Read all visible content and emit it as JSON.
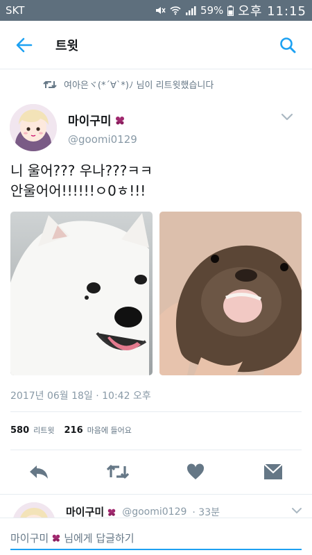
{
  "status_bar": {
    "carrier": "SKT",
    "battery": "59%",
    "time": "오후 11:15"
  },
  "app_bar": {
    "title": "트윗"
  },
  "retweet_context": {
    "text": "여아은ヾ(*´∀`*)ﾉ 님이 리트윗했습니다"
  },
  "tweet": {
    "author_name": "마이구미",
    "author_handle": "@goomi0129",
    "text_line1": "니 울어??? 우나???ㅋㅋ",
    "text_line2": "안울어어!!!!!!ㅇ0ㅎ!!!",
    "media": [
      {
        "name": "samoyed-dog-photo",
        "alt": "white fluffy dog"
      },
      {
        "name": "otter-photo",
        "alt": "otter held in hand"
      }
    ],
    "timestamp": "2017년 06월 18일 · 10:42 오후",
    "retweets_count": "580",
    "retweets_label": "리트윗",
    "likes_count": "216",
    "likes_label": "마음에 들어요"
  },
  "actions": {
    "reply_icon": "reply-icon",
    "retweet_icon": "retweet-icon",
    "like_icon": "heart-icon",
    "dm_icon": "direct-message-icon"
  },
  "reply_preview": {
    "author_name": "마이구미",
    "author_handle": "@goomi0129",
    "age": "· 33분"
  },
  "compose": {
    "to_name": "마이구미",
    "placeholder_suffix": "님에게 답글하기"
  },
  "colors": {
    "accent": "#1da1f2",
    "status_bar": "#5e6f7d",
    "secondary_text": "#8899a6",
    "icon_gray": "#657786",
    "badge": "#a0286e"
  }
}
